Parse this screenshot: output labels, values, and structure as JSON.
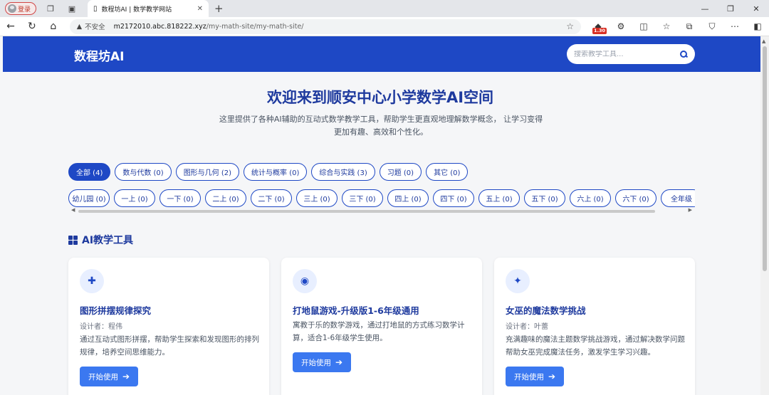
{
  "browser": {
    "login_label": "登录",
    "tab_title": "数程坊AI | 数学教学网站",
    "new_tab": "+",
    "security_label": "不安全",
    "url_host": "m2172010.abc.818222.xyz",
    "url_path": "/my-math-site/my-math-site/",
    "ext_badge": "1.30"
  },
  "header": {
    "brand": "数程坊AI",
    "search_placeholder": "搜索教学工具..."
  },
  "hero": {
    "title": "欢迎来到顺安中心小学数学AI空间",
    "desc_line1": "这里提供了各种AI辅助的互动式数学教学工具，帮助学生更直观地理解数学概念， 让学习变得",
    "desc_line2": "更加有趣、高效和个性化。"
  },
  "categories": [
    "全部 (4)",
    "数与代数 (0)",
    "图形与几何 (2)",
    "统计与概率 (0)",
    "综合与实践 (3)",
    "习题 (0)",
    "其它 (0)"
  ],
  "grades": [
    "幼儿园 (0)",
    "一上 (0)",
    "一下 (0)",
    "二上 (0)",
    "二下 (0)",
    "三上 (0)",
    "三下 (0)",
    "四上 (0)",
    "四下 (0)",
    "五上 (0)",
    "五下 (0)",
    "六上 (0)",
    "六下 (0)",
    "全年级"
  ],
  "section_title": "AI教学工具",
  "cards": [
    {
      "icon": "puzzle-icon",
      "title": "图形拼摆规律探究",
      "designer": "设计者：程伟",
      "desc": "通过互动式图形拼摆，帮助学生探索和发现图形的排列规律，培养空间思维能力。",
      "button": "开始使用"
    },
    {
      "icon": "gamepad-icon",
      "title": "打地鼠游戏-升级版1-6年级通用",
      "designer": "",
      "desc": "寓教于乐的数学游戏，通过打地鼠的方式练习数学计算，适合1-6年级学生使用。",
      "button": "开始使用"
    },
    {
      "icon": "magic-wand-icon",
      "title": "女巫的魔法数学挑战",
      "designer": "设计者：叶蕾",
      "desc": "充满趣味的魔法主题数学挑战游戏，通过解决数学问题帮助女巫完成魔法任务，激发学生学习兴趣。",
      "button": "开始使用"
    }
  ]
}
